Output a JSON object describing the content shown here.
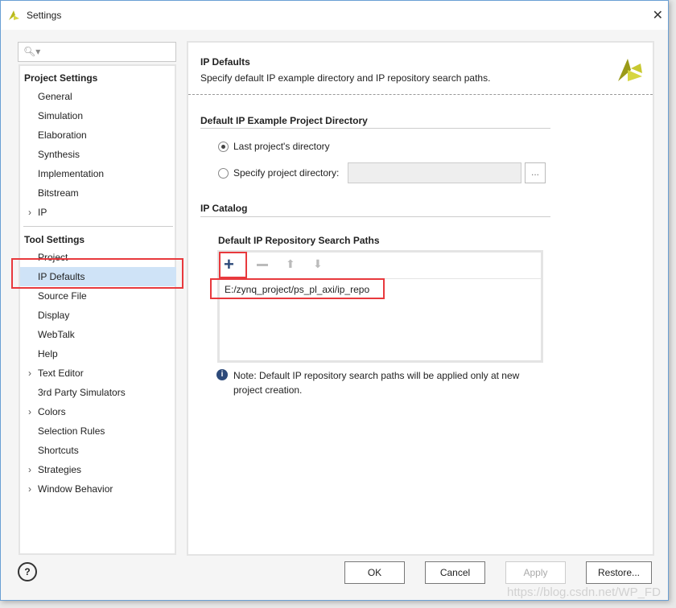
{
  "window": {
    "title": "Settings"
  },
  "search": {
    "placeholder": ""
  },
  "sidebar": {
    "project_settings": "Project Settings",
    "project_items": [
      "General",
      "Simulation",
      "Elaboration",
      "Synthesis",
      "Implementation",
      "Bitstream",
      "IP"
    ],
    "tool_settings": "Tool Settings",
    "tool_items": [
      "Project",
      "IP Defaults",
      "Source File",
      "Display",
      "WebTalk",
      "Help",
      "Text Editor",
      "3rd Party Simulators",
      "Colors",
      "Selection Rules",
      "Shortcuts",
      "Strategies",
      "Window Behavior"
    ],
    "selected": "IP Defaults"
  },
  "main": {
    "title": "IP Defaults",
    "subtitle": "Specify default IP example directory and IP repository search paths.",
    "section1": "Default IP Example Project Directory",
    "radio1": "Last project's directory",
    "radio2": "Specify project directory:",
    "browse": "...",
    "section2": "IP Catalog",
    "repo_label": "Default IP Repository Search Paths",
    "paths": [
      "E:/zynq_project/ps_pl_axi/ip_repo"
    ],
    "note": "Note: Default IP repository search paths will be applied only at new project creation."
  },
  "buttons": {
    "ok": "OK",
    "cancel": "Cancel",
    "apply": "Apply",
    "restore": "Restore..."
  },
  "help": "?",
  "watermark": "https://blog.csdn.net/WP_FD"
}
